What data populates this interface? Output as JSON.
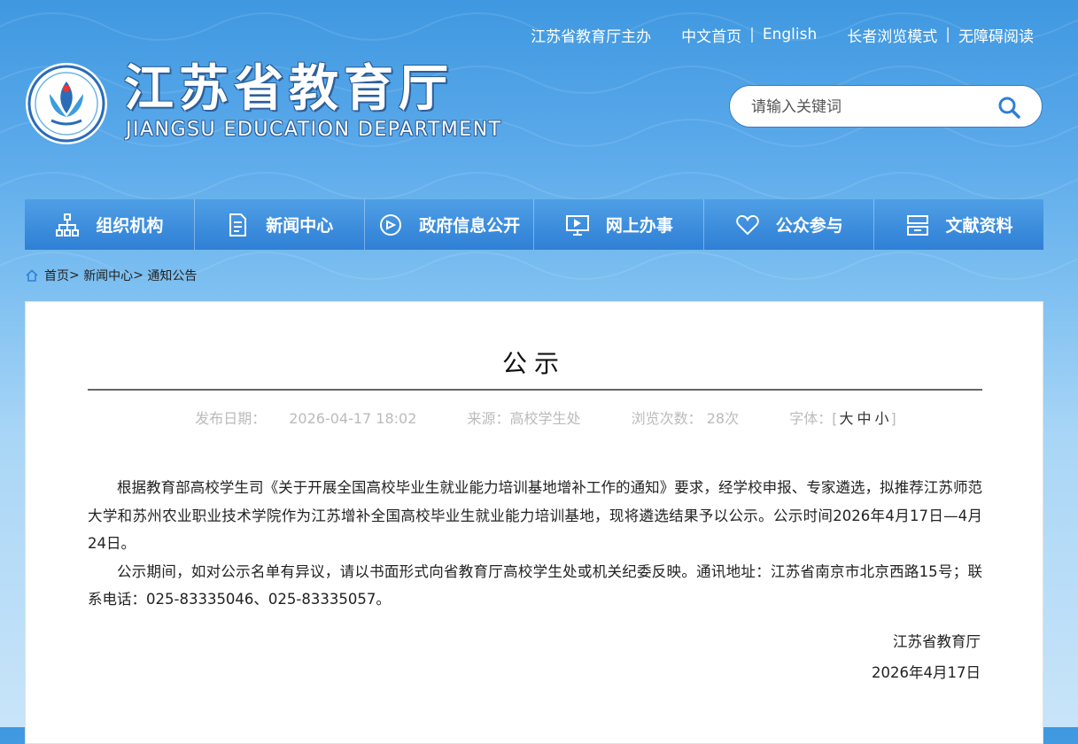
{
  "header": {
    "links_left": "江苏省教育厅主办",
    "links": [
      "中文首页",
      "English"
    ],
    "links_right": [
      "长者浏览模式",
      "无障碍阅读"
    ],
    "title_cn": "江苏省教育厅",
    "title_en": "JIANGSU EDUCATION DEPARTMENT",
    "search_placeholder": "请输入关键词"
  },
  "nav": {
    "items": [
      {
        "label": "组织机构",
        "icon": "org-chart-icon"
      },
      {
        "label": "新闻中心",
        "icon": "document-icon"
      },
      {
        "label": "政府信息公开",
        "icon": "megaphone-icon"
      },
      {
        "label": "网上办事",
        "icon": "monitor-icon"
      },
      {
        "label": "公众参与",
        "icon": "heart-icon"
      },
      {
        "label": "文献资料",
        "icon": "archive-icon"
      }
    ]
  },
  "breadcrumb": [
    "首页",
    "新闻中心",
    "通知公告"
  ],
  "article": {
    "title": "公示",
    "publish_label": "发布日期：",
    "publish_date": "2026-04-17 18:02",
    "source_label": "来源：",
    "source": "高校学生处",
    "views_label": "浏览次数：",
    "views": "28次",
    "font_label": "字体：",
    "font_sizes": [
      "大",
      "中",
      "小"
    ],
    "paragraphs": [
      "根据教育部高校学生司《关于开展全国高校毕业生就业能力培训基地增补工作的通知》要求，经学校申报、专家遴选，拟推荐江苏师范大学和苏州农业职业技术学院作为江苏增补全国高校毕业生就业能力培训基地，现将遴选结果予以公示。公示时间2026年4月17日—4月24日。",
      "公示期间，如对公示名单有异议，请以书面形式向省教育厅高校学生处或机关纪委反映。通讯地址：江苏省南京市北京西路15号；联系电话：025-83335046、025-83335057。"
    ],
    "signature": "江苏省教育厅",
    "sign_date": "2026年4月17日"
  },
  "colors": {
    "nav": "#3a8ddf",
    "accent": "#2f7fd6"
  }
}
